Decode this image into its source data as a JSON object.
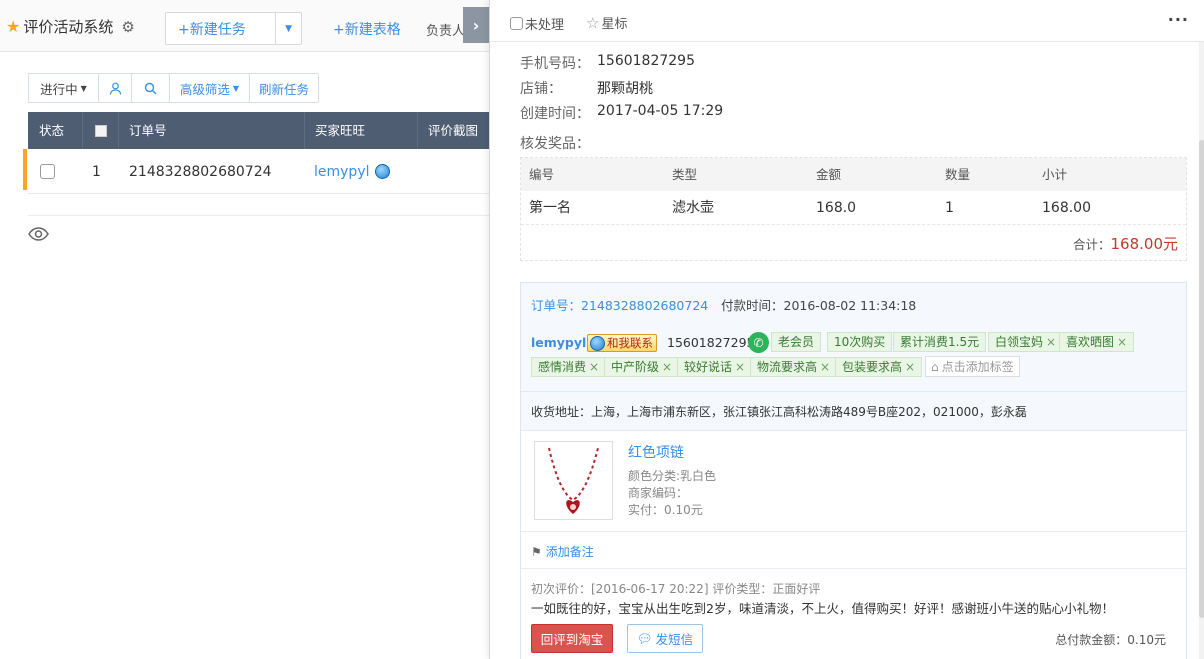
{
  "app": {
    "title": "评价活动系统",
    "new_task_label": "新建任务",
    "new_sheet_label": "新建表格",
    "owner_label": "负责人"
  },
  "toolbar": {
    "status_label": "进行中",
    "advanced_filter_label": "高级筛选",
    "refresh_label": "刷新任务"
  },
  "grid": {
    "columns": [
      "状态",
      "订单号",
      "买家旺旺",
      "评价截图"
    ],
    "rows": [
      {
        "index": "1",
        "order_no": "2148328802680724",
        "buyer": "lemypyl"
      }
    ]
  },
  "panel": {
    "unprocessed_label": "未处理",
    "star_label": "星标",
    "info": {
      "phone_label": "手机号码：",
      "phone": "15601827295",
      "shop_label": "店铺：",
      "shop": "那颗胡桃",
      "created_label": "创建时间：",
      "created": "2017-04-05 17:29",
      "prize_label": "核发奖品："
    },
    "prize_table": {
      "headers": [
        "编号",
        "类型",
        "金额",
        "数量",
        "小计"
      ],
      "rows": [
        {
          "no": "第一名",
          "type": "滤水壶",
          "amount": "168.0",
          "qty": "1",
          "subtotal": "168.00"
        }
      ],
      "total_label": "合计：",
      "total": "168.00元"
    },
    "order": {
      "order_no_label": "订单号：2148328802680724",
      "pay_time_label": "付款时间：2016-08-02 11:34:18",
      "buyer": "lemypyl",
      "contact_label": "和我联系",
      "phone": "15601827295",
      "tags": [
        "老会员",
        "10次购买",
        "累计消费1.5元",
        "白领宝妈",
        "喜欢晒图",
        "感情消费",
        "中产阶级",
        "较好说话",
        "物流要求高",
        "包装要求高"
      ],
      "add_tag_label": "点击添加标签",
      "address": "收货地址：上海，上海市浦东新区，张江镇张江高科松涛路489号B座202，021000，彭永磊",
      "product": {
        "name": "红色项链",
        "color": "颜色分类:乳白色",
        "merchant_code": "商家编码：",
        "paid": "实付：0.10元"
      },
      "add_note_label": "添加备注",
      "review_meta": "初次评价：[2016-06-17 20:22] 评价类型：正面好评",
      "review_text": "一如既往的好，宝宝从出生吃到2岁，味道清淡，不上火，值得购买！好评！感谢班小牛送的贴心小礼物！",
      "reply_label": "回评到淘宝",
      "sms_label": "发短信",
      "total_pay": "总付款金额：0.10元"
    }
  },
  "colors": {
    "accent": "#3a8ee6",
    "header_bg": "#4f5d73",
    "danger": "#d9534f",
    "price": "#c0392b",
    "marker": "#f5a623"
  }
}
